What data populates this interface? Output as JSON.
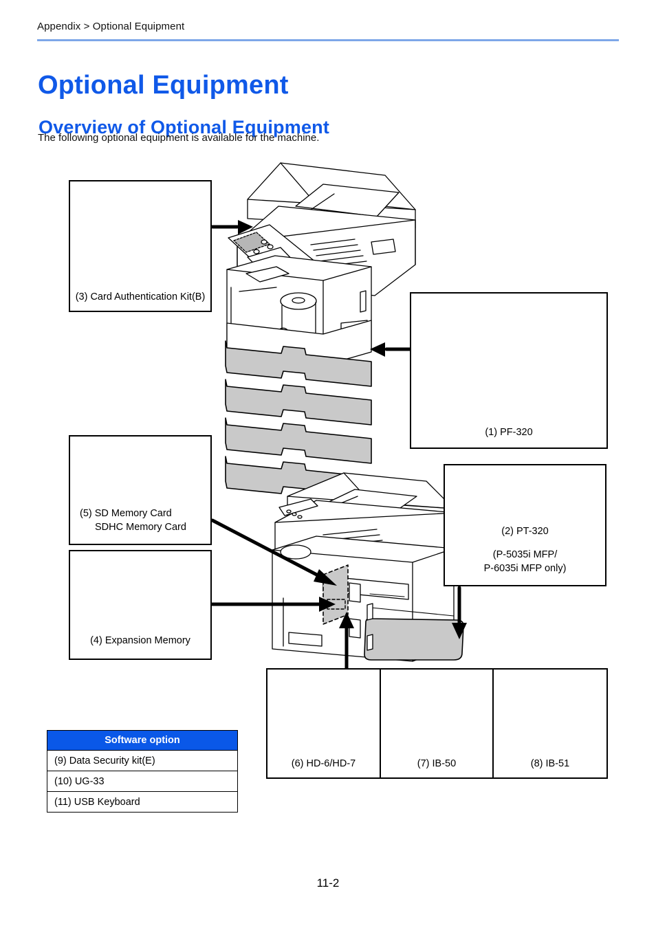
{
  "header": {
    "breadcrumb": "Appendix > Optional Equipment",
    "title": "Optional Equipment",
    "subtitle": "Overview of Optional Equipment",
    "intro": "The following optional equipment is available for the machine."
  },
  "colors": {
    "heading_blue": "#1059e8",
    "rule_blue": "#7da7e8",
    "table_header_blue": "#0a58e8",
    "part_gray": "#8d8fa6",
    "tray_gray": "#c9c9c9"
  },
  "callouts": [
    {
      "id": "card_auth",
      "label": "(3) Card Authentication Kit(B)",
      "label2": ""
    },
    {
      "id": "pf320",
      "label": "(1) PF-320",
      "label2": ""
    },
    {
      "id": "pt320",
      "label": "(2) PT-320",
      "label2": "(P-5035i MFP/",
      "label3": "P-6035i MFP only)"
    },
    {
      "id": "sd_card",
      "label": "(5) SD Memory Card",
      "label2": "SDHC Memory Card"
    },
    {
      "id": "expansion_memory",
      "label": "(4) Expansion Memory",
      "label2": ""
    }
  ],
  "interface_cards": [
    {
      "label": "(6) HD-6/HD-7"
    },
    {
      "label": "(7) IB-50"
    },
    {
      "label": "(8) IB-51"
    }
  ],
  "software_table": {
    "header": "Software option",
    "rows": [
      "(9) Data Security kit(E)",
      "(10) UG-33",
      "(11) USB Keyboard"
    ]
  },
  "footer": {
    "page_number": "11-2"
  }
}
